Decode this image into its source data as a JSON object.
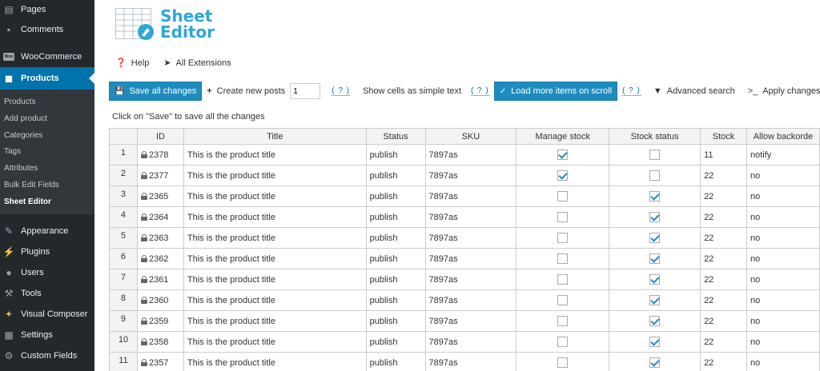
{
  "sidebar": {
    "items_top": [
      {
        "label": "Pages",
        "icon": "pages-icon"
      },
      {
        "label": "Comments",
        "icon": "comments-icon"
      }
    ],
    "woocommerce": {
      "label": "WooCommerce",
      "badge": "Woo"
    },
    "products": {
      "label": "Products"
    },
    "submenu": [
      "Products",
      "Add product",
      "Categories",
      "Tags",
      "Attributes",
      "Bulk Edit Fields",
      "Sheet Editor"
    ],
    "items_bottom": [
      {
        "label": "Appearance",
        "icon": "appearance-icon"
      },
      {
        "label": "Plugins",
        "icon": "plugins-icon"
      },
      {
        "label": "Users",
        "icon": "users-icon"
      },
      {
        "label": "Tools",
        "icon": "tools-icon"
      },
      {
        "label": "Visual Composer",
        "icon": "visual-composer-icon"
      },
      {
        "label": "Settings",
        "icon": "settings-icon"
      },
      {
        "label": "Custom Fields",
        "icon": "custom-fields-icon"
      }
    ],
    "active_color": "#0073aa",
    "bg_color": "#23282d"
  },
  "logo": {
    "line1": "Sheet",
    "line2": "Editor",
    "color": "#2ea6d8"
  },
  "helpbar": {
    "help": "Help",
    "extensions": "All Extensions"
  },
  "toolbar": {
    "save_all": "Save all changes",
    "create_posts": "Create new posts",
    "create_count": "1",
    "help_marker": "( ? )",
    "simple_text": "Show cells as simple text",
    "load_more": "Load more items on scroll",
    "advanced_search": "Advanced search",
    "apply_bulk": "Apply changes in bulk",
    "accent": "#1e8cbe"
  },
  "save_hint": "Click on \"Save\" to save all the changes",
  "grid": {
    "columns": [
      "",
      "ID",
      "Title",
      "Status",
      "SKU",
      "Manage stock",
      "Stock status",
      "Stock",
      "Allow backorde"
    ],
    "rows": [
      {
        "num": "1",
        "id": "2378",
        "title": "This is the product title",
        "status": "publish",
        "sku": "7897as",
        "manage": true,
        "instock": false,
        "stock": "11",
        "backorders": "notify"
      },
      {
        "num": "2",
        "id": "2377",
        "title": "This is the product title",
        "status": "publish",
        "sku": "7897as",
        "manage": true,
        "instock": false,
        "stock": "22",
        "backorders": "no"
      },
      {
        "num": "3",
        "id": "2365",
        "title": "This is the product title",
        "status": "publish",
        "sku": "7897as",
        "manage": false,
        "instock": true,
        "stock": "22",
        "backorders": "no"
      },
      {
        "num": "4",
        "id": "2364",
        "title": "This is the product title",
        "status": "publish",
        "sku": "7897as",
        "manage": false,
        "instock": true,
        "stock": "22",
        "backorders": "no"
      },
      {
        "num": "5",
        "id": "2363",
        "title": "This is the product title",
        "status": "publish",
        "sku": "7897as",
        "manage": false,
        "instock": true,
        "stock": "22",
        "backorders": "no"
      },
      {
        "num": "6",
        "id": "2362",
        "title": "This is the product title",
        "status": "publish",
        "sku": "7897as",
        "manage": false,
        "instock": true,
        "stock": "22",
        "backorders": "no"
      },
      {
        "num": "7",
        "id": "2361",
        "title": "This is the product title",
        "status": "publish",
        "sku": "7897as",
        "manage": false,
        "instock": true,
        "stock": "22",
        "backorders": "no"
      },
      {
        "num": "8",
        "id": "2360",
        "title": "This is the product title",
        "status": "publish",
        "sku": "7897as",
        "manage": false,
        "instock": true,
        "stock": "22",
        "backorders": "no"
      },
      {
        "num": "9",
        "id": "2359",
        "title": "This is the product title",
        "status": "publish",
        "sku": "7897as",
        "manage": false,
        "instock": true,
        "stock": "22",
        "backorders": "no"
      },
      {
        "num": "10",
        "id": "2358",
        "title": "This is the product title",
        "status": "publish",
        "sku": "7897as",
        "manage": false,
        "instock": true,
        "stock": "22",
        "backorders": "no"
      },
      {
        "num": "11",
        "id": "2357",
        "title": "This is the product title",
        "status": "publish",
        "sku": "7897as",
        "manage": false,
        "instock": true,
        "stock": "22",
        "backorders": "no"
      }
    ]
  }
}
